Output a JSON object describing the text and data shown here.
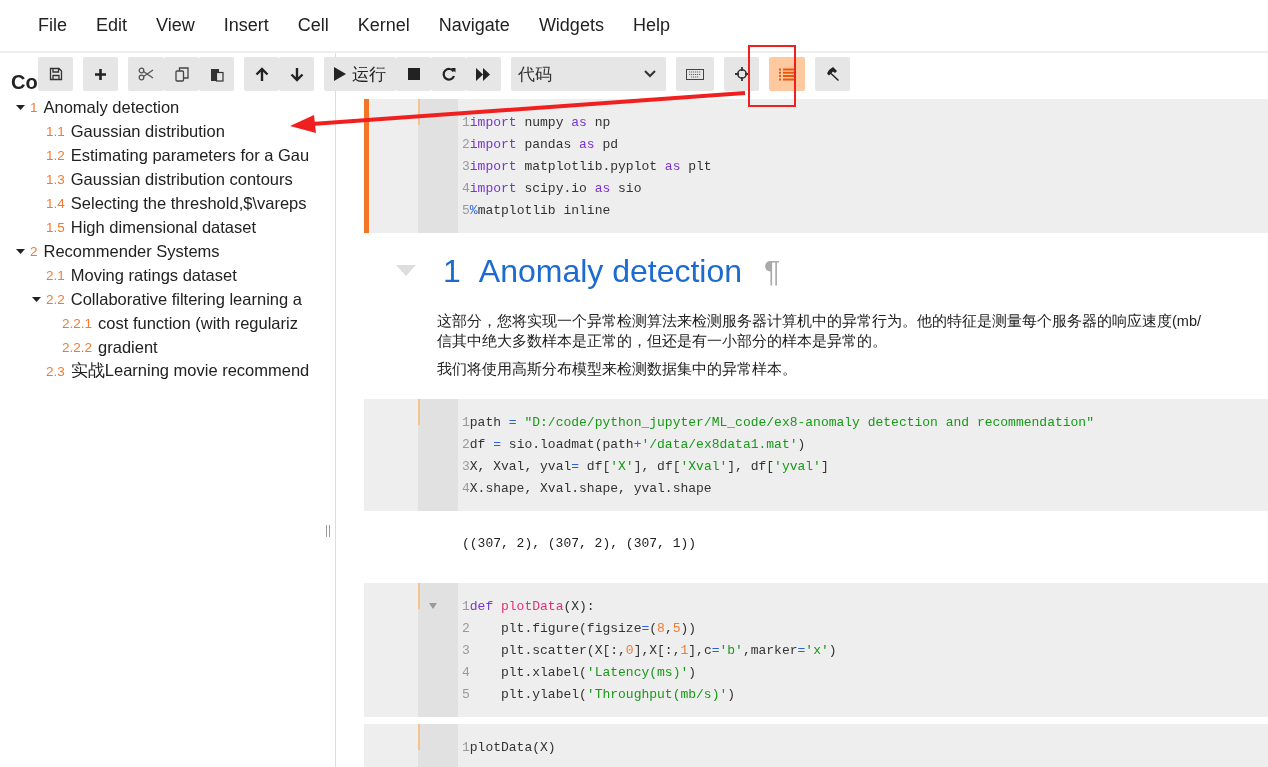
{
  "menu": [
    "File",
    "Edit",
    "View",
    "Insert",
    "Cell",
    "Kernel",
    "Navigate",
    "Widgets",
    "Help"
  ],
  "toolbar": {
    "run_label": "运行",
    "cell_type": "代码",
    "toc_toggle": {
      "selected": true
    }
  },
  "toc": {
    "title": "Co",
    "items": [
      {
        "number": "1",
        "label": "Anomaly detection",
        "expanded": true,
        "children": [
          {
            "number": "1.1",
            "label": "Gaussian distribution"
          },
          {
            "number": "1.2",
            "label": "Estimating parameters for a Gau"
          },
          {
            "number": "1.3",
            "label": "Gaussian distribution contours"
          },
          {
            "number": "1.4",
            "label": "Selecting the threshold,$\\vareps"
          },
          {
            "number": "1.5",
            "label": "High dimensional dataset"
          }
        ]
      },
      {
        "number": "2",
        "label": "Recommender Systems",
        "expanded": true,
        "children": [
          {
            "number": "2.1",
            "label": "Moving ratings dataset"
          },
          {
            "number": "2.2",
            "label": "Collaborative filtering learning a",
            "expanded": true,
            "children": [
              {
                "number": "2.2.1",
                "label": "cost function (with regulariz"
              },
              {
                "number": "2.2.2",
                "label": "gradient"
              }
            ]
          },
          {
            "number": "2.3",
            "label": "实战Learning movie recommend"
          }
        ]
      }
    ]
  },
  "cells": [
    {
      "kind": "code",
      "selected": true,
      "lines": [
        {
          "n": "1",
          "tokens": [
            {
              "kind": "keyword",
              "text": "import"
            },
            " numpy ",
            {
              "kind": "keyword",
              "text": "as"
            },
            " np"
          ]
        },
        {
          "n": "2",
          "tokens": [
            {
              "kind": "keyword",
              "text": "import"
            },
            " pandas ",
            {
              "kind": "keyword",
              "text": "as"
            },
            " pd"
          ]
        },
        {
          "n": "3",
          "tokens": [
            {
              "kind": "keyword",
              "text": "import"
            },
            " matplotlib.pyplot ",
            {
              "kind": "keyword",
              "text": "as"
            },
            " plt"
          ]
        },
        {
          "n": "4",
          "tokens": [
            {
              "kind": "keyword",
              "text": "import"
            },
            " scipy.io ",
            {
              "kind": "keyword",
              "text": "as"
            },
            " sio"
          ]
        },
        {
          "n": "5",
          "tokens": [
            {
              "kind": "operator",
              "text": "%"
            },
            "matplotlib inline"
          ]
        }
      ]
    },
    {
      "kind": "heading",
      "number": "1",
      "title": "Anomaly detection",
      "anchor": "¶",
      "paragraphs": [
        [
          "这部分，您将实现一个异常检测算法来检测服务器计算机中的异常行为。他的特征是测量每个服务器的响应速度(mb/",
          "信其中绝大多数样本是正常的，但还是有一小部分的样本是异常的。"
        ],
        [
          "我们将使用高斯分布模型来检测数据集中的异常样本。"
        ]
      ]
    },
    {
      "kind": "code",
      "selected": false,
      "lines": [
        {
          "n": "1",
          "tokens": [
            "path ",
            {
              "kind": "operator",
              "text": "="
            },
            {
              "kind": "string",
              "text": " \"D:/code/python_jupyter/ML_code/ex8-anomaly detection and recommendation\""
            }
          ]
        },
        {
          "n": "2",
          "tokens": [
            "df ",
            {
              "kind": "operator",
              "text": "="
            },
            " sio.loadmat(path",
            {
              "kind": "operator",
              "text": "+"
            },
            {
              "kind": "string",
              "text": "'/data/ex8data1.mat'"
            },
            ")"
          ]
        },
        {
          "n": "3",
          "tokens": [
            "X, Xval, yval",
            {
              "kind": "operator",
              "text": "="
            },
            " df[",
            {
              "kind": "string",
              "text": "'X'"
            },
            "], df[",
            {
              "kind": "string",
              "text": "'Xval'"
            },
            "], df[",
            {
              "kind": "string",
              "text": "'yval'"
            },
            "]"
          ]
        },
        {
          "n": "4",
          "tokens": [
            "X.shape, Xval.shape, yval.shape"
          ]
        }
      ]
    },
    {
      "kind": "output",
      "text": "((307, 2), (307, 2), (307, 1))"
    },
    {
      "kind": "code",
      "selected": false,
      "lines": [
        {
          "n": "1",
          "fold": true,
          "tokens": [
            {
              "kind": "keyword",
              "text": "def"
            },
            {
              "kind": "function",
              "text": " plotData"
            },
            "(X):"
          ]
        },
        {
          "n": "2",
          "tokens": [
            "    plt.figure(figsize",
            {
              "kind": "operator",
              "text": "="
            },
            "(",
            {
              "kind": "number",
              "text": "8"
            },
            ",",
            {
              "kind": "number",
              "text": "5"
            },
            "))"
          ]
        },
        {
          "n": "3",
          "tokens": [
            "    plt.scatter(X[:,",
            {
              "kind": "number",
              "text": "0"
            },
            "],X[:,",
            {
              "kind": "number",
              "text": "1"
            },
            "],c",
            {
              "kind": "operator",
              "text": "="
            },
            {
              "kind": "string",
              "text": "'b'"
            },
            ",marker",
            {
              "kind": "operator",
              "text": "="
            },
            {
              "kind": "string",
              "text": "'x'"
            },
            ")"
          ]
        },
        {
          "n": "4",
          "tokens": [
            "    plt.xlabel(",
            {
              "kind": "string",
              "text": "'Latency(ms)'"
            },
            ")"
          ]
        },
        {
          "n": "5",
          "tokens": [
            "    plt.ylabel(",
            {
              "kind": "string",
              "text": "'Throughput(mb/s)'"
            },
            ")"
          ]
        }
      ]
    },
    {
      "kind": "code",
      "selected": false,
      "lines": [
        {
          "n": "1",
          "tokens": [
            "plotData(X)"
          ]
        }
      ]
    }
  ]
}
